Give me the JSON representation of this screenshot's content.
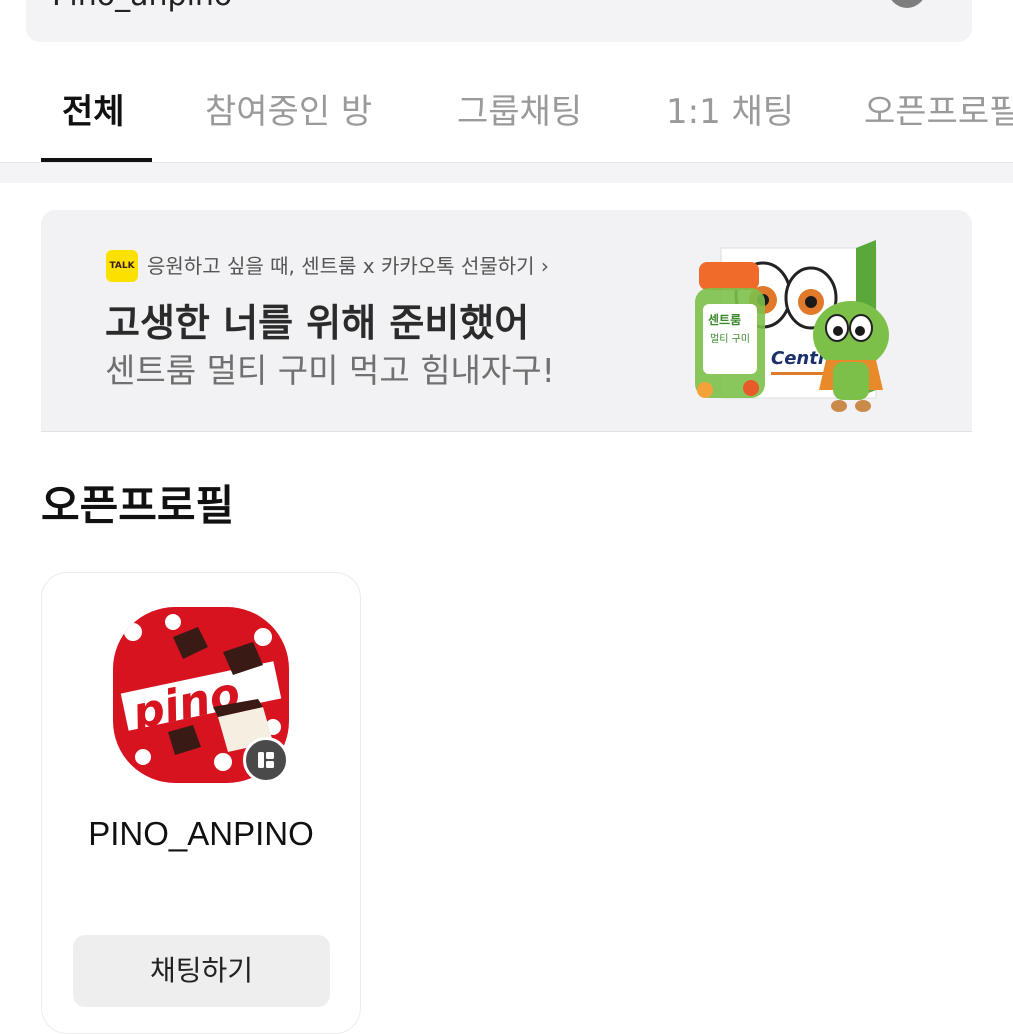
{
  "search": {
    "value": "Pino_anpino"
  },
  "tabs": [
    {
      "label": "전체",
      "active": true
    },
    {
      "label": "참여중인 방",
      "active": false
    },
    {
      "label": "그룹채팅",
      "active": false
    },
    {
      "label": "1:1 채팅",
      "active": false
    },
    {
      "label": "오픈프로필",
      "active": false
    }
  ],
  "ad": {
    "badge": "TALK",
    "subtitle": "응원하고 싶을 때, 센트룸 x 카카오톡 선물하기 ›",
    "title": "고생한 너를 위해 준비했어",
    "description": "센트룸 멀티 구미 먹고 힘내자구!",
    "product": {
      "jar_label_1": "센트룸",
      "jar_label_2": "멀티 구미",
      "brand": "Centrum"
    },
    "colors": {
      "badge": "#fae100",
      "jar_lid": "#f06a2a",
      "mascot": "#7cc04a"
    }
  },
  "section": {
    "title": "오픈프로필"
  },
  "profile": {
    "name": "PINO_ANPINO",
    "avatar_text": "pino",
    "button_label": "채팅하기",
    "avatar_colors": {
      "box": "#d7131f",
      "dot": "#ffffff"
    }
  }
}
